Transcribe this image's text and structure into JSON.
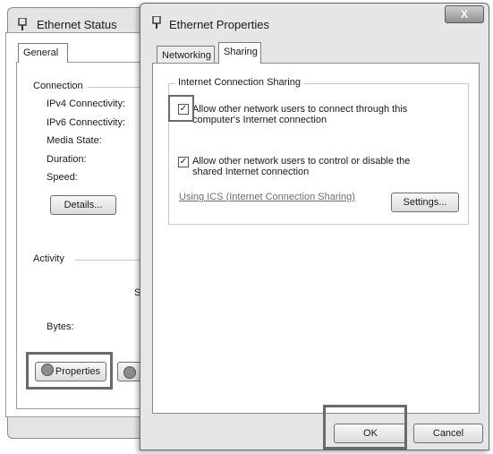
{
  "status_window": {
    "title": "Ethernet Status",
    "tab": "General",
    "connection_label": "Connection",
    "rows": [
      "IPv4 Connectivity:",
      "IPv6 Connectivity:",
      "Media State:",
      "Duration:",
      "Speed:"
    ],
    "details_button": "Details...",
    "activity_label": "Activity",
    "partial_char": "S",
    "bytes_label": "Bytes:",
    "properties_button": "Properties"
  },
  "properties_window": {
    "title": "Ethernet Properties",
    "close_label": "X",
    "tabs": [
      "Networking",
      "Sharing"
    ],
    "group_title": "Internet Connection Sharing",
    "allow_connect": {
      "checked": true,
      "line1": "Allow other network users to connect through this",
      "line2": "computer's Internet connection"
    },
    "allow_control": {
      "checked": true,
      "line1": "Allow other network users to control or disable the",
      "line2": "shared Internet connection"
    },
    "ics_link": "Using ICS (Internet Connection Sharing)",
    "settings_button": "Settings...",
    "ok_button": "OK",
    "cancel_button": "Cancel"
  },
  "checkmark": "✓"
}
